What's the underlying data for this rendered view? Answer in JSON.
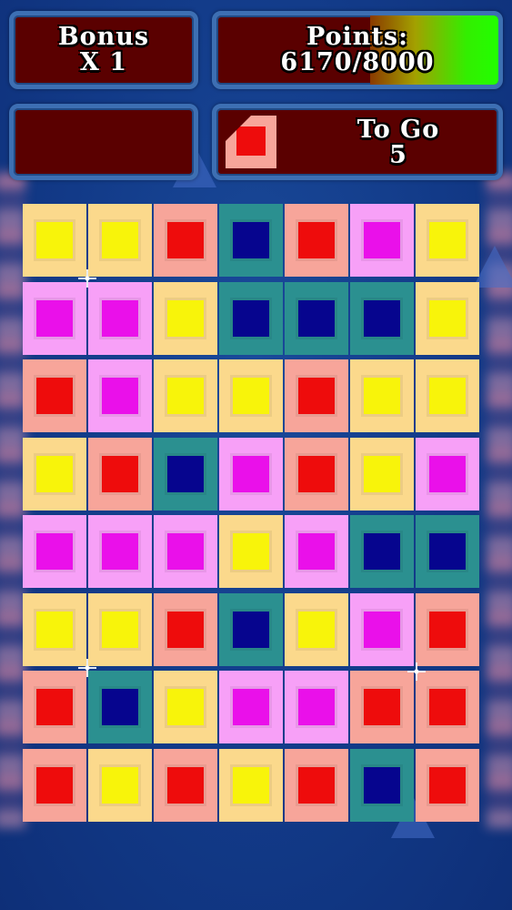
{
  "hud": {
    "bonus_label": "Bonus",
    "bonus_value": "X 1",
    "points_label": "Points:",
    "points_value": "6170/8000",
    "points_progress": 0.625,
    "togo_label": "To Go",
    "togo_value": "5",
    "target_tile": "red"
  },
  "colors": {
    "yellow": {
      "outer": "#fbd98c",
      "inner": "#f8f40a"
    },
    "red": {
      "outer": "#f7a59a",
      "inner": "#ee0c0c"
    },
    "navy": {
      "outer": "#2b9090",
      "inner": "#06058e"
    },
    "magenta": {
      "outer": "#f7a0f7",
      "inner": "#ea10ea"
    }
  },
  "board": [
    [
      "yellow",
      "yellow",
      "red",
      "navy",
      "red",
      "magenta",
      "yellow"
    ],
    [
      "magenta",
      "magenta",
      "yellow",
      "navy",
      "navy",
      "navy",
      "yellow"
    ],
    [
      "red",
      "magenta",
      "yellow",
      "yellow",
      "red",
      "yellow",
      "yellow"
    ],
    [
      "yellow",
      "red",
      "navy",
      "magenta",
      "red",
      "yellow",
      "magenta"
    ],
    [
      "magenta",
      "magenta",
      "magenta",
      "yellow",
      "magenta",
      "navy",
      "navy"
    ],
    [
      "yellow",
      "yellow",
      "red",
      "navy",
      "yellow",
      "magenta",
      "red"
    ],
    [
      "red",
      "navy",
      "yellow",
      "magenta",
      "magenta",
      "red",
      "red"
    ],
    [
      "red",
      "yellow",
      "red",
      "yellow",
      "red",
      "navy",
      "red"
    ]
  ]
}
